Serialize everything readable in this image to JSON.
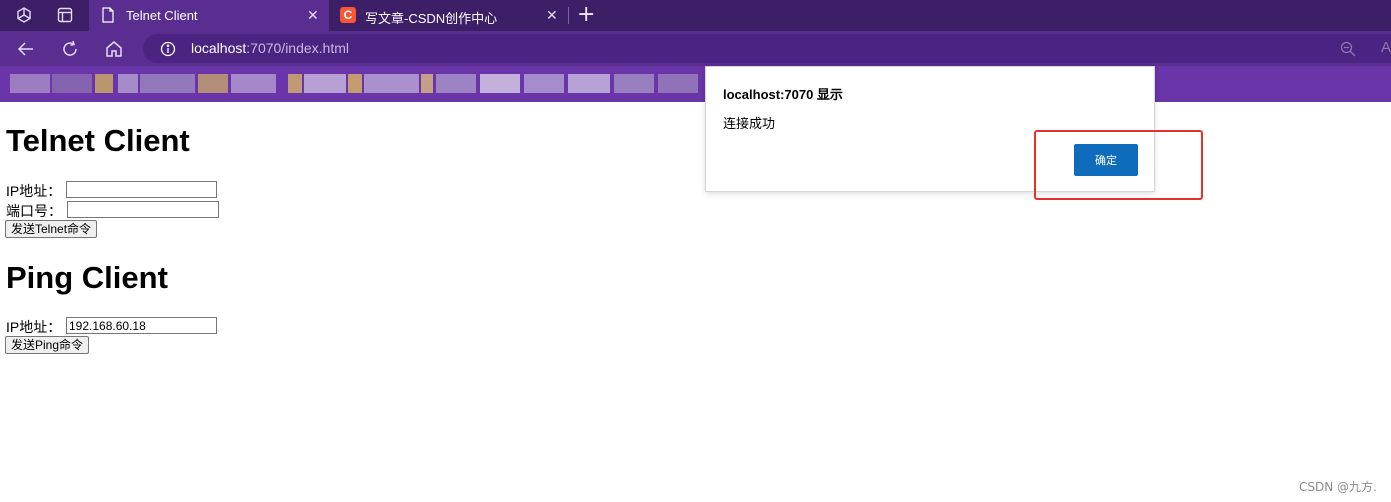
{
  "browser": {
    "tabs": [
      {
        "label": "Telnet Client",
        "icon": "document-icon",
        "active": true
      },
      {
        "label": "写文章-CSDN创作中心",
        "icon": "csdn-icon",
        "icon_text": "C",
        "active": false
      }
    ],
    "address": {
      "host": "localhost",
      "path": ":7070/index.html"
    },
    "colors": {
      "frame": "#3d1f68",
      "toolbar": "#5a2d91",
      "favorites_bar": "#6a35a8"
    }
  },
  "page": {
    "telnet": {
      "heading": "Telnet Client",
      "ip_label": "IP地址：",
      "ip_value": "",
      "port_label": "端口号：",
      "port_value": "",
      "send_button": "发送Telnet命令"
    },
    "ping": {
      "heading": "Ping Client",
      "ip_label": "IP地址：",
      "ip_value": "192.168.60.18",
      "send_button": "发送Ping命令"
    }
  },
  "dialog": {
    "title": "localhost:7070 显示",
    "message": "连接成功",
    "ok_button": "确定",
    "ok_color": "#0f6cbd",
    "highlight_color": "#e8302b"
  },
  "watermark": "CSDN @九方."
}
